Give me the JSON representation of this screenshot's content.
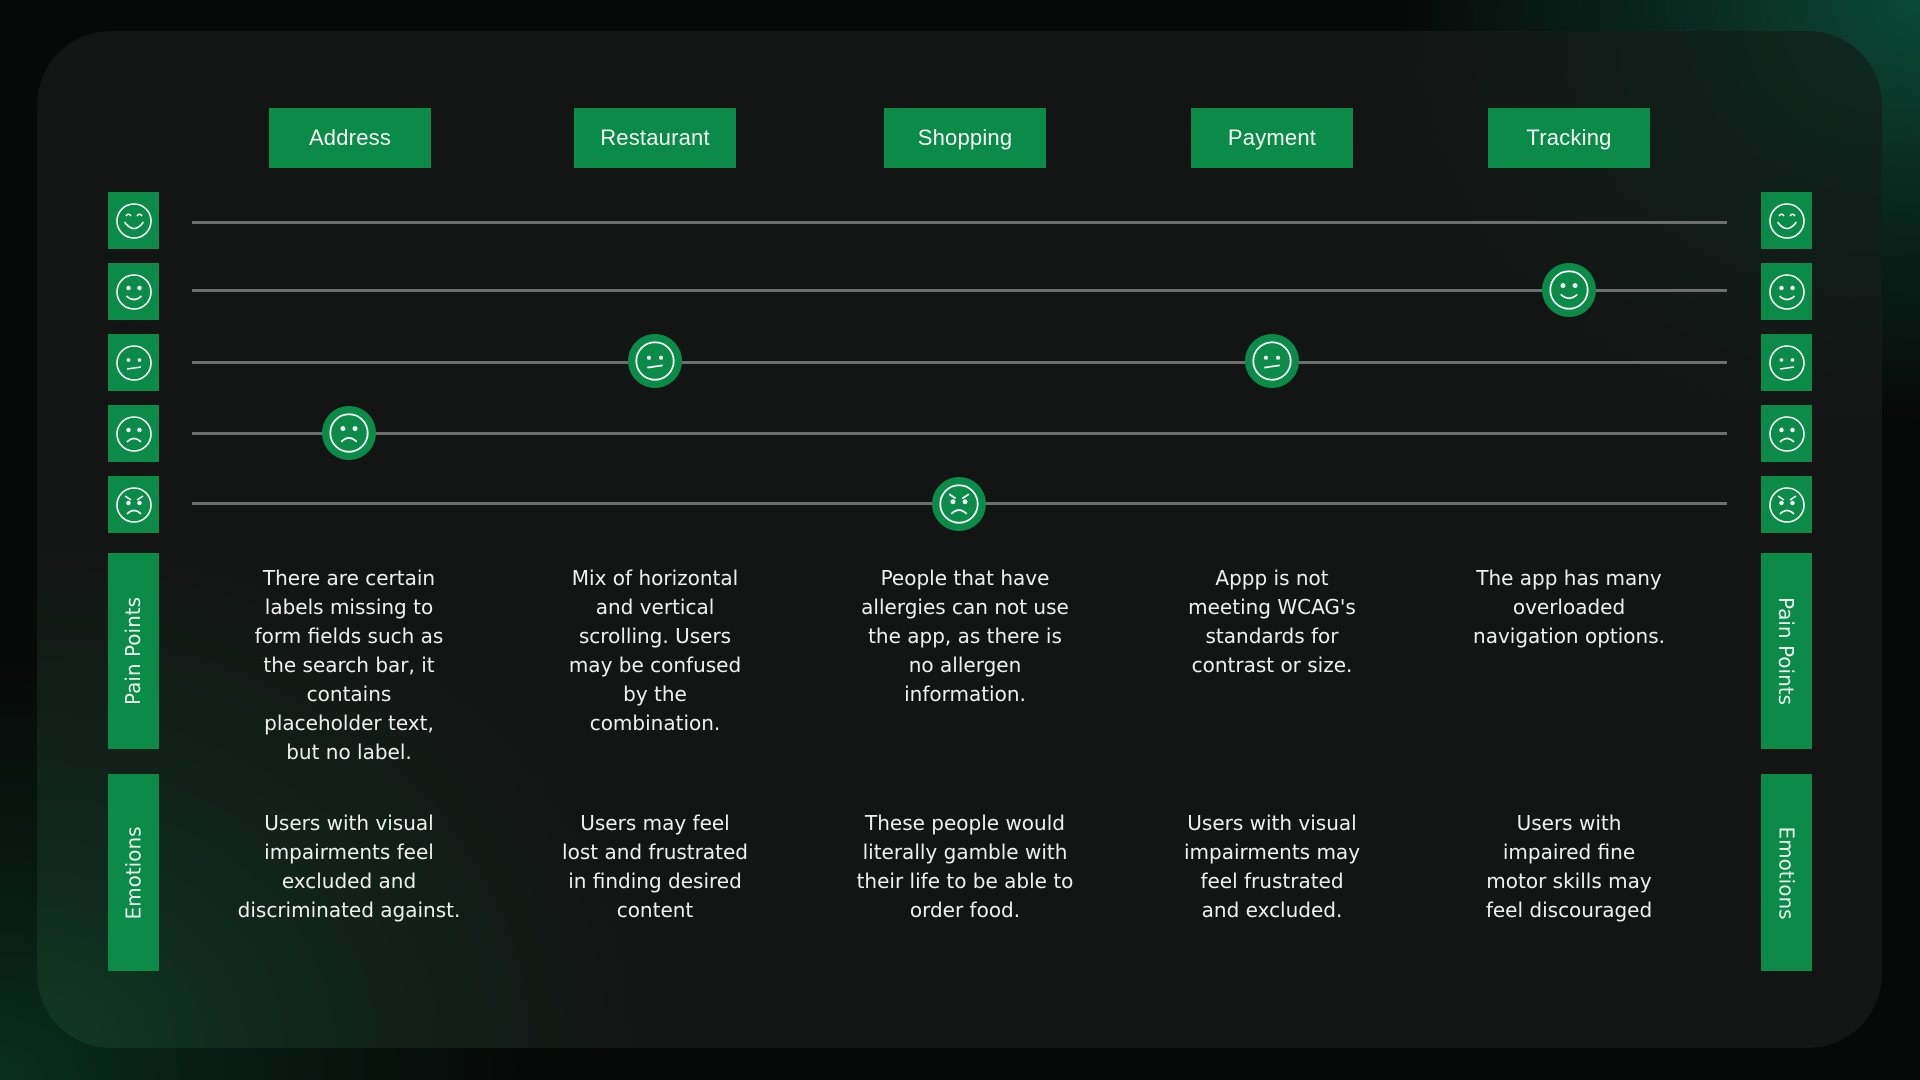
{
  "colors": {
    "accent_green": "#0b8a48",
    "card_background": "#131414",
    "track_line": "#6d6e6e",
    "text": "#eef0ef"
  },
  "stages": [
    {
      "label": "Address"
    },
    {
      "label": "Restaurant"
    },
    {
      "label": "Shopping"
    },
    {
      "label": "Payment"
    },
    {
      "label": "Tracking"
    }
  ],
  "emotion_scale": [
    {
      "level": 5,
      "icon": "very-happy-face-icon"
    },
    {
      "level": 4,
      "icon": "happy-face-icon"
    },
    {
      "level": 3,
      "icon": "neutral-face-icon"
    },
    {
      "level": 2,
      "icon": "sad-face-icon"
    },
    {
      "level": 1,
      "icon": "angry-face-icon"
    }
  ],
  "journey_markers": [
    {
      "stage": "Address",
      "level": 2,
      "icon": "sad-face-icon"
    },
    {
      "stage": "Restaurant",
      "level": 3,
      "icon": "neutral-face-icon"
    },
    {
      "stage": "Shopping",
      "level": 1,
      "icon": "angry-face-icon"
    },
    {
      "stage": "Payment",
      "level": 3,
      "icon": "neutral-face-icon"
    },
    {
      "stage": "Tracking",
      "level": 4,
      "icon": "happy-face-icon"
    }
  ],
  "row_labels": {
    "pain_points": "Pain Points",
    "emotions": "Emotions"
  },
  "pain_points": [
    "There are certain\nlabels missing to\nform fields such as\nthe search bar, it\ncontains\nplaceholder text,\nbut no label.",
    "Mix of horizontal\nand vertical\nscrolling. Users\nmay be confused\nby the\ncombination.",
    "People that have\nallergies can not use\nthe app, as there is\nno allergen\ninformation.",
    "Appp is not\nmeeting WCAG's\nstandards for\ncontrast or size.",
    "The app has many\noverloaded\nnavigation options."
  ],
  "emotions": [
    "Users with visual\nimpairments feel\nexcluded and\ndiscriminated against.",
    "Users may feel\nlost and frustrated\nin finding desired\ncontent",
    "These people  would\nliterally gamble with\ntheir life to be able to\norder food.",
    "Users with visual\nimpairments may\nfeel frustrated\nand excluded.",
    "Users with\nimpaired fine\nmotor skills may\nfeel discouraged"
  ]
}
